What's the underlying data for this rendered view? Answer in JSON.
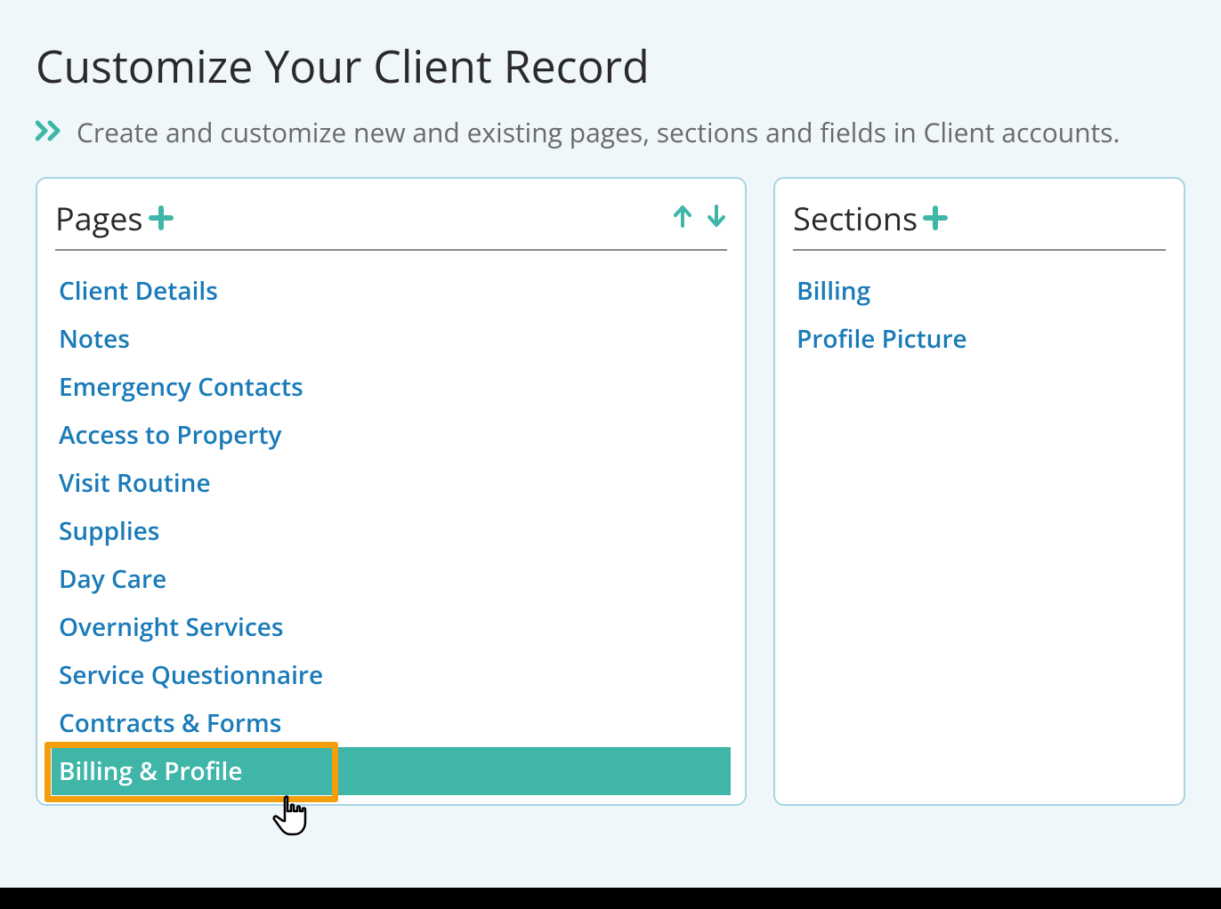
{
  "header": {
    "title": "Customize Your Client Record",
    "subtitle": "Create and customize new and existing pages, sections and fields in Client accounts."
  },
  "pagesPanel": {
    "title": "Pages",
    "items": [
      {
        "label": "Client Details",
        "selected": false
      },
      {
        "label": "Notes",
        "selected": false
      },
      {
        "label": "Emergency Contacts",
        "selected": false
      },
      {
        "label": "Access to Property",
        "selected": false
      },
      {
        "label": "Visit Routine",
        "selected": false
      },
      {
        "label": "Supplies",
        "selected": false
      },
      {
        "label": "Day Care",
        "selected": false
      },
      {
        "label": "Overnight Services",
        "selected": false
      },
      {
        "label": "Service Questionnaire",
        "selected": false
      },
      {
        "label": "Contracts & Forms",
        "selected": false
      },
      {
        "label": "Billing & Profile",
        "selected": true
      }
    ]
  },
  "sectionsPanel": {
    "title": "Sections",
    "items": [
      {
        "label": "Billing"
      },
      {
        "label": "Profile Picture"
      }
    ]
  }
}
